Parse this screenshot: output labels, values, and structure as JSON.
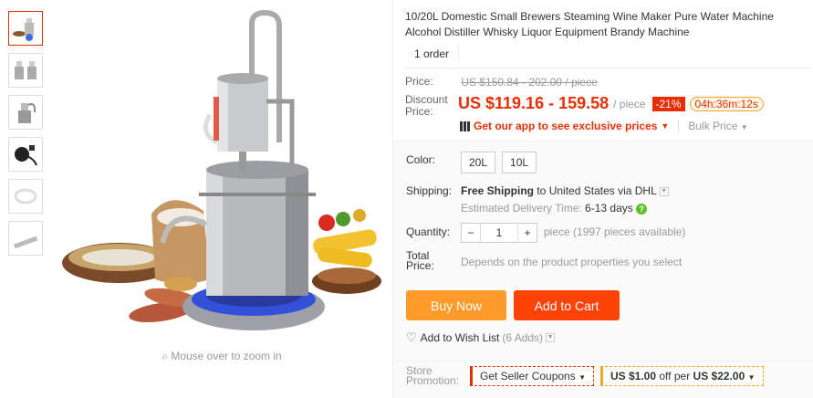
{
  "gallery": {
    "zoom_hint": "Mouse over to zoom in",
    "thumbnails": [
      "distiller-set",
      "two-distillers",
      "distiller-parts",
      "heater-plug",
      "tubing",
      "ruler-bar"
    ]
  },
  "product": {
    "title": "10/20L Domestic Small Brewers Steaming Wine Maker Pure Water Machine Alcohol Distiller Whisky Liquor Equipment Brandy Machine",
    "orders": "1 order"
  },
  "price": {
    "price_label": "Price:",
    "original": "US $150.84 - 202.00 / piece",
    "discount_label_1": "Discount",
    "discount_label_2": "Price:",
    "discount_price": "US $119.16 - 159.58",
    "per_piece": "/ piece",
    "discount_pct": "-21%",
    "timer": "04h:36m:12s",
    "app_promo": "Get our app to see exclusive prices",
    "bulk": "Bulk Price"
  },
  "options": {
    "color_label": "Color:",
    "colors": [
      "20L",
      "10L"
    ],
    "shipping_label": "Shipping:",
    "shipping_free": "Free Shipping",
    "shipping_to": " to ",
    "shipping_country": "United States via DHL",
    "delivery_label": "Estimated Delivery Time:",
    "delivery_days": "6-13 days",
    "quantity_label": "Quantity:",
    "quantity_value": "1",
    "quantity_note": "piece (1997 pieces available)",
    "total_label_1": "Total",
    "total_label_2": "Price:",
    "total_note": "Depends on the product properties you select"
  },
  "actions": {
    "buy_now": "Buy Now",
    "add_to_cart": "Add to Cart",
    "wishlist": "Add to Wish List",
    "wishlist_count": "(6 Adds)"
  },
  "promotion": {
    "label_1": "Store",
    "label_2": "Promotion:",
    "coupon": "Get Seller Coupons",
    "deal_amount": "US $1.00",
    "deal_mid": " off per ",
    "deal_threshold": "US $22.00"
  },
  "colors": {
    "accent": "#e62e04",
    "buy_now": "#ff9a2b",
    "add_to_cart": "#ff4206"
  }
}
